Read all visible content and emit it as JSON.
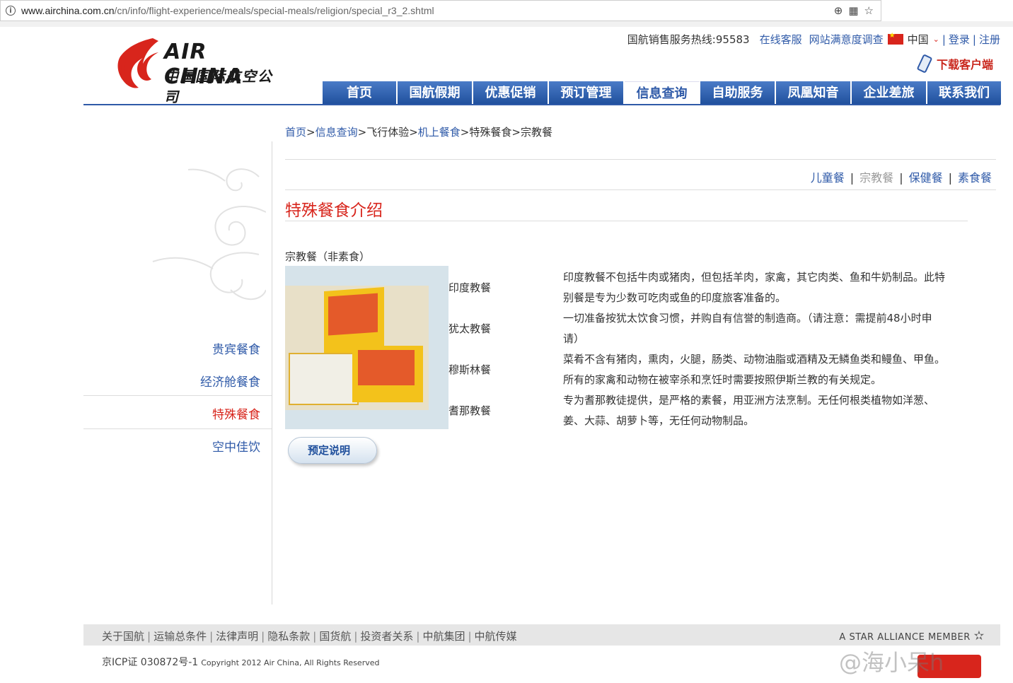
{
  "browser": {
    "url_host": "www.airchina.com.cn",
    "url_path": "/cn/info/flight-experience/meals/special-meals/religion/special_r3_2.shtml"
  },
  "logo": {
    "en": "AIR CHINA",
    "cn": "中国国际航空公司"
  },
  "topbar": {
    "hotline": "国航销售服务热线:95583",
    "online_service": "在线客服",
    "survey": "网站满意度调查",
    "region": "中国",
    "login": "登录",
    "register": "注册",
    "sep": "|"
  },
  "download_app": "下载客户端",
  "nav": [
    {
      "label": "首页"
    },
    {
      "label": "国航假期"
    },
    {
      "label": "优惠促销"
    },
    {
      "label": "预订管理"
    },
    {
      "label": "信息查询"
    },
    {
      "label": "自助服务"
    },
    {
      "label": "凤凰知音"
    },
    {
      "label": "企业差旅"
    },
    {
      "label": "联系我们"
    }
  ],
  "breadcrumb": {
    "home": "首页",
    "info": "信息查询",
    "flight": "飞行体验",
    "meals": "机上餐食",
    "special": "特殊餐食",
    "current": "宗教餐",
    "gt": ">"
  },
  "subtabs": {
    "child": "儿童餐",
    "religion": "宗教餐",
    "health": "保健餐",
    "vegetarian": "素食餐",
    "sep": "|"
  },
  "page_title": "特殊餐食介绍",
  "sidebar": {
    "items": [
      {
        "label": "贵宾餐食"
      },
      {
        "label": "经济舱餐食"
      },
      {
        "label": "特殊餐食"
      },
      {
        "label": "空中佳饮"
      }
    ]
  },
  "meal_heading": "宗教餐（非素食）",
  "meal_types": [
    {
      "label": "印度教餐"
    },
    {
      "label": "犹太教餐"
    },
    {
      "label": "穆斯林餐"
    },
    {
      "label": "耆那教餐"
    }
  ],
  "descriptions": [
    "印度教餐不包括牛肉或猪肉，但包括羊肉，家禽，其它肉类、鱼和牛奶制品。此特别餐是专为少数可吃肉或鱼的印度旅客准备的。",
    "一切准备按犹太饮食习惯，并购自有信誉的制造商。（请注意：需提前48小时申请）",
    "菜肴不含有猪肉，熏肉，火腿，肠类、动物油脂或酒精及无鳞鱼类和鳗鱼、甲鱼。所有的家禽和动物在被宰杀和烹饪时需要按照伊斯兰教的有关规定。",
    "专为耆那教徒提供，是严格的素餐，用亚洲方法烹制。无任何根类植物如洋葱、姜、大蒜、胡萝卜等，无任何动物制品。"
  ],
  "reserve_button": "预定说明",
  "footer": {
    "links": [
      {
        "label": "关于国航"
      },
      {
        "label": "运输总条件"
      },
      {
        "label": "法律声明"
      },
      {
        "label": "隐私条款"
      },
      {
        "label": "国货航"
      },
      {
        "label": "投资者关系"
      },
      {
        "label": "中航集团"
      },
      {
        "label": "中航传媒"
      }
    ],
    "sep": "|",
    "star_alliance": "A STAR ALLIANCE MEMBER",
    "icp": "京ICP证 030872号-1",
    "copyright": "Copyright 2012 Air China, All Rights Reserved"
  },
  "watermark": "@海小呆h",
  "colors": {
    "brand_red": "#d8251c",
    "link_blue": "#2f5aa8",
    "nav_blue": "#1f4f9c"
  }
}
